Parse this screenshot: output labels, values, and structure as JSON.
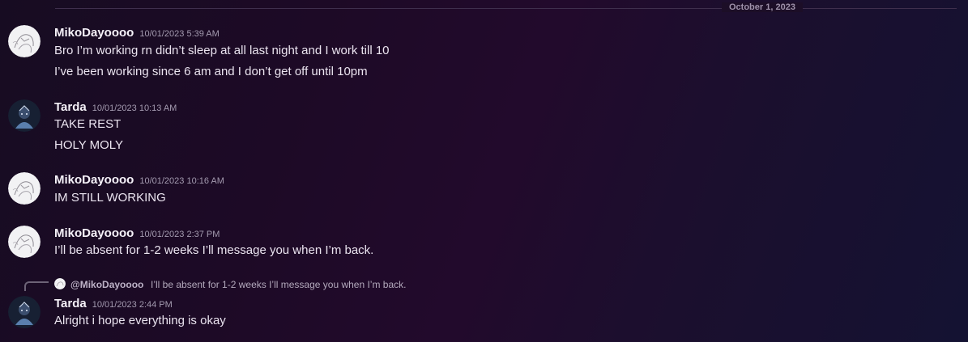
{
  "date_divider": "October 1, 2023",
  "messages": [
    {
      "author": "MikoDayoooo",
      "timestamp": "10/01/2023 5:39 AM",
      "lines": [
        "Bro I’m working rn didn’t sleep at all last night and I work till 10",
        "I’ve been working since 6 am and I don’t get off until 10pm"
      ]
    },
    {
      "author": "Tarda",
      "timestamp": "10/01/2023 10:13 AM",
      "lines": [
        "TAKE REST",
        "HOLY MOLY"
      ]
    },
    {
      "author": "MikoDayoooo",
      "timestamp": "10/01/2023 10:16 AM",
      "lines": [
        "IM STILL WORKING"
      ]
    },
    {
      "author": "MikoDayoooo",
      "timestamp": "10/01/2023 2:37 PM",
      "lines": [
        "I’ll be absent for 1-2 weeks I’ll message you when I’m back."
      ]
    },
    {
      "author": "Tarda",
      "timestamp": "10/01/2023 2:44 PM",
      "reply": {
        "author": "@MikoDayoooo",
        "text": "I’ll be absent for 1-2 weeks I’ll message you when I’m back."
      },
      "lines": [
        "Alright i hope everything is okay"
      ]
    }
  ],
  "avatars": {
    "MikoDayoooo": "sketch-avatar",
    "Tarda": "dark-character-avatar"
  },
  "colors": {
    "username": "#f5f1f8",
    "timestamp": "#a49bb0",
    "message_text": "#ebe4f0",
    "divider_line": "#3f2f4d",
    "background_mid": "#220a2c"
  }
}
